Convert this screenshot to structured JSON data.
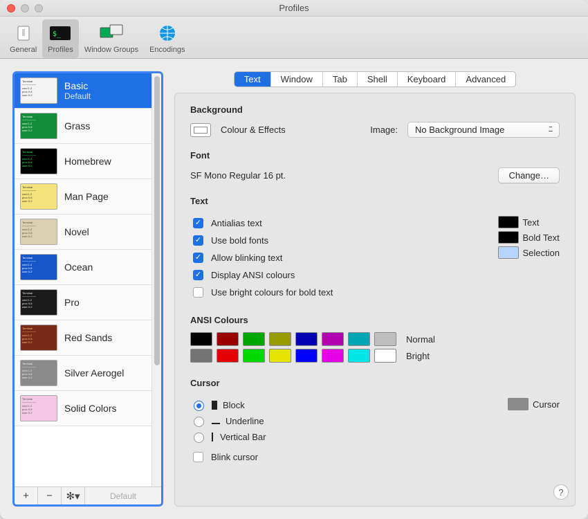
{
  "window": {
    "title": "Profiles"
  },
  "toolbar": {
    "items": [
      {
        "label": "General"
      },
      {
        "label": "Profiles"
      },
      {
        "label": "Window Groups"
      },
      {
        "label": "Encodings"
      }
    ],
    "selected_index": 1
  },
  "sidebar": {
    "profiles": [
      {
        "name": "Basic",
        "subtitle": "Default",
        "bg": "#f4f4f4",
        "fg": "#333"
      },
      {
        "name": "Grass",
        "bg": "#138c3a",
        "fg": "#ffe"
      },
      {
        "name": "Homebrew",
        "bg": "#000000",
        "fg": "#29ff58"
      },
      {
        "name": "Man Page",
        "bg": "#f4e27a",
        "fg": "#333"
      },
      {
        "name": "Novel",
        "bg": "#d9cfb1",
        "fg": "#5a4a3a"
      },
      {
        "name": "Ocean",
        "bg": "#1556c9",
        "fg": "#fff"
      },
      {
        "name": "Pro",
        "bg": "#1a1a1a",
        "fg": "#eaeaea"
      },
      {
        "name": "Red Sands",
        "bg": "#7a2a18",
        "fg": "#f2c474"
      },
      {
        "name": "Silver Aerogel",
        "bg": "#8a8a8a",
        "fg": "#eee"
      },
      {
        "name": "Solid Colors",
        "bg": "#f3c8e2",
        "fg": "#555"
      }
    ],
    "selected_index": 0,
    "footer_default": "Default"
  },
  "tabs": {
    "items": [
      "Text",
      "Window",
      "Tab",
      "Shell",
      "Keyboard",
      "Advanced"
    ],
    "active_index": 0
  },
  "sections": {
    "background": {
      "title": "Background",
      "effects_label": "Colour & Effects",
      "image_label": "Image:",
      "image_value": "No Background Image"
    },
    "font": {
      "title": "Font",
      "value": "SF Mono Regular 16 pt.",
      "change_btn": "Change…"
    },
    "text": {
      "title": "Text",
      "checks": [
        {
          "label": "Antialias text",
          "checked": true
        },
        {
          "label": "Use bold fonts",
          "checked": true
        },
        {
          "label": "Allow blinking text",
          "checked": true
        },
        {
          "label": "Display ANSI colours",
          "checked": true
        },
        {
          "label": "Use bright colours for bold text",
          "checked": false
        }
      ],
      "swatches": [
        {
          "label": "Text",
          "color": "#000000"
        },
        {
          "label": "Bold Text",
          "color": "#000000"
        },
        {
          "label": "Selection",
          "color": "#b5d5ff"
        }
      ]
    },
    "ansi": {
      "title": "ANSI Colours",
      "normal_label": "Normal",
      "bright_label": "Bright",
      "normal": [
        "#000000",
        "#990000",
        "#00a600",
        "#999900",
        "#0000b2",
        "#b200b2",
        "#00a6b2",
        "#bfbfbf"
      ],
      "bright": [
        "#747474",
        "#e50000",
        "#00d900",
        "#e5e500",
        "#0000ff",
        "#e500e5",
        "#00e5e5",
        "#ffffff"
      ]
    },
    "cursor": {
      "title": "Cursor",
      "options": [
        {
          "label": "Block",
          "kind": "block",
          "selected": true
        },
        {
          "label": "Underline",
          "kind": "under",
          "selected": false
        },
        {
          "label": "Vertical Bar",
          "kind": "bar",
          "selected": false
        }
      ],
      "blink_label": "Blink cursor",
      "blink_checked": false,
      "swatch_label": "Cursor",
      "swatch_color": "#8b8b8b"
    }
  }
}
